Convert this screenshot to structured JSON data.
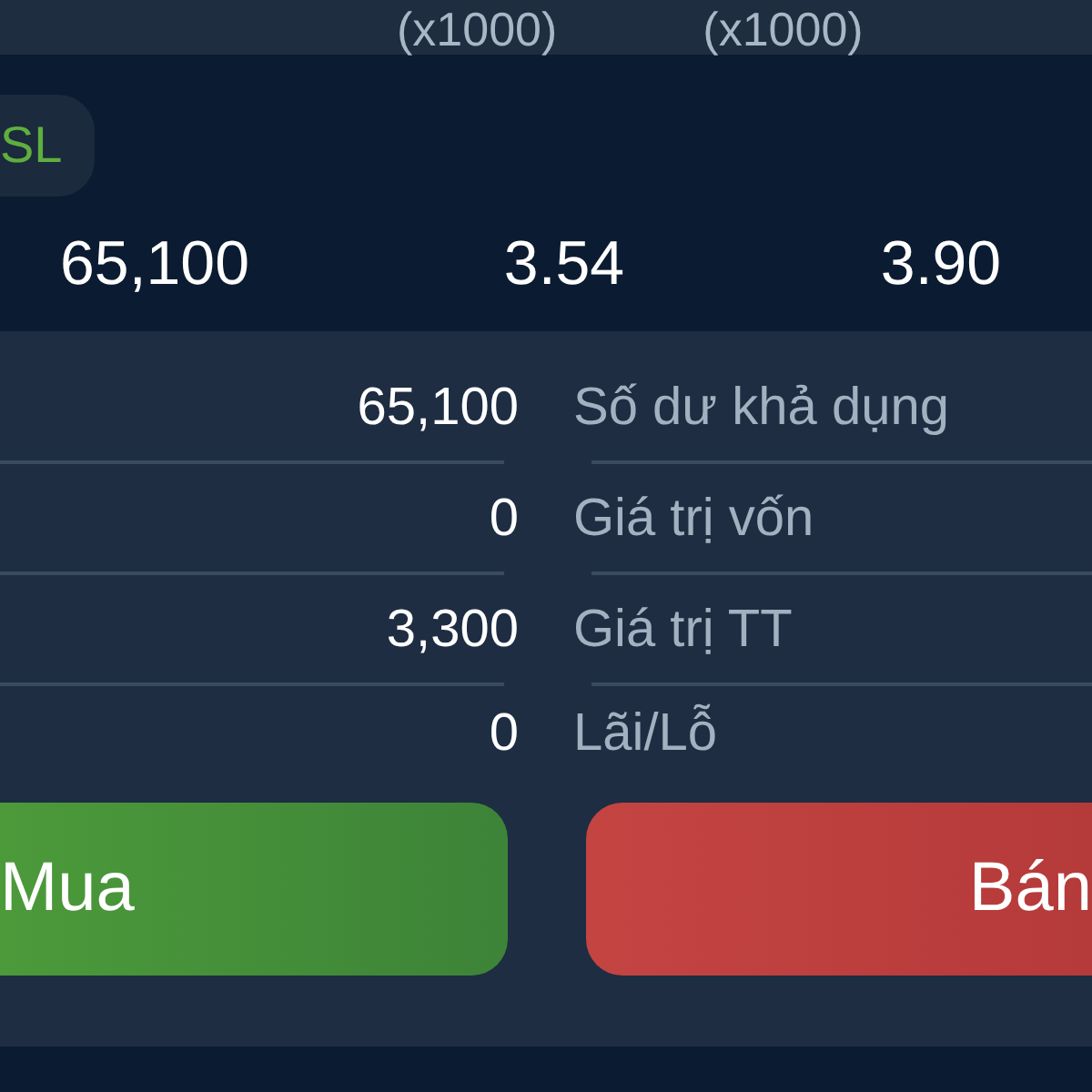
{
  "header": {
    "columns": [
      "(x1000)",
      "(x1000)"
    ]
  },
  "tag": {
    "label": "SL"
  },
  "summary": {
    "values": [
      "65,100",
      "3.54",
      "3.90"
    ]
  },
  "balances": [
    {
      "value": "65,100",
      "label": "Số dư khả dụng"
    },
    {
      "value": "0",
      "label": "Giá trị vốn"
    },
    {
      "value": "3,300",
      "label": "Giá trị TT"
    },
    {
      "value": "0",
      "label": "Lãi/Lỗ"
    }
  ],
  "buttons": [
    {
      "kind": "buy",
      "label": "Mua"
    },
    {
      "kind": "sell",
      "label": "Bán"
    }
  ]
}
